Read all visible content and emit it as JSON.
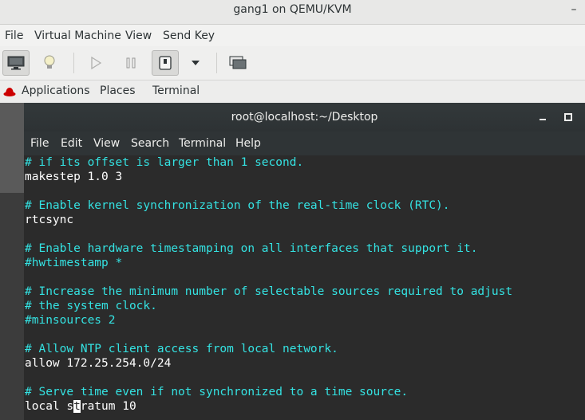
{
  "window": {
    "title": "gang1 on QEMU/KVM",
    "minimize_glyph": "–"
  },
  "vm_menu": [
    "File",
    "Virtual Machine",
    "View",
    "Send Key"
  ],
  "vm_toolbar": [
    "console-icon",
    "details-lightbulb-icon",
    "run-icon",
    "pause-icon",
    "shutdown-icon",
    "dropdown-icon",
    "screenshot-icon"
  ],
  "gnome_bar": {
    "applications": "Applications",
    "places": "Places",
    "terminal": "Terminal"
  },
  "terminal": {
    "title": "root@localhost:~/Desktop",
    "menu": [
      "File",
      "Edit",
      "View",
      "Search",
      "Terminal",
      "Help"
    ],
    "lines": [
      "# if its offset is larger than 1 second.",
      "makestep 1.0 3",
      "",
      "# Enable kernel synchronization of the real-time clock (RTC).",
      "rtcsync",
      "",
      "# Enable hardware timestamping on all interfaces that support it.",
      "#hwtimestamp *",
      "",
      "# Increase the minimum number of selectable sources required to adjust",
      "# the system clock.",
      "#minsources 2",
      "",
      "# Allow NTP client access from local network.",
      "allow 172.25.254.0/24",
      "",
      "# Serve time even if not synchronized to a time source.",
      "local stratum 10"
    ],
    "last_line_parts": {
      "before": "local s",
      "cursor": "t",
      "after": "ratum 10"
    }
  },
  "colors": {
    "comment": "#34e2e2",
    "text": "#ffffff",
    "background": "#2b2b2b"
  }
}
